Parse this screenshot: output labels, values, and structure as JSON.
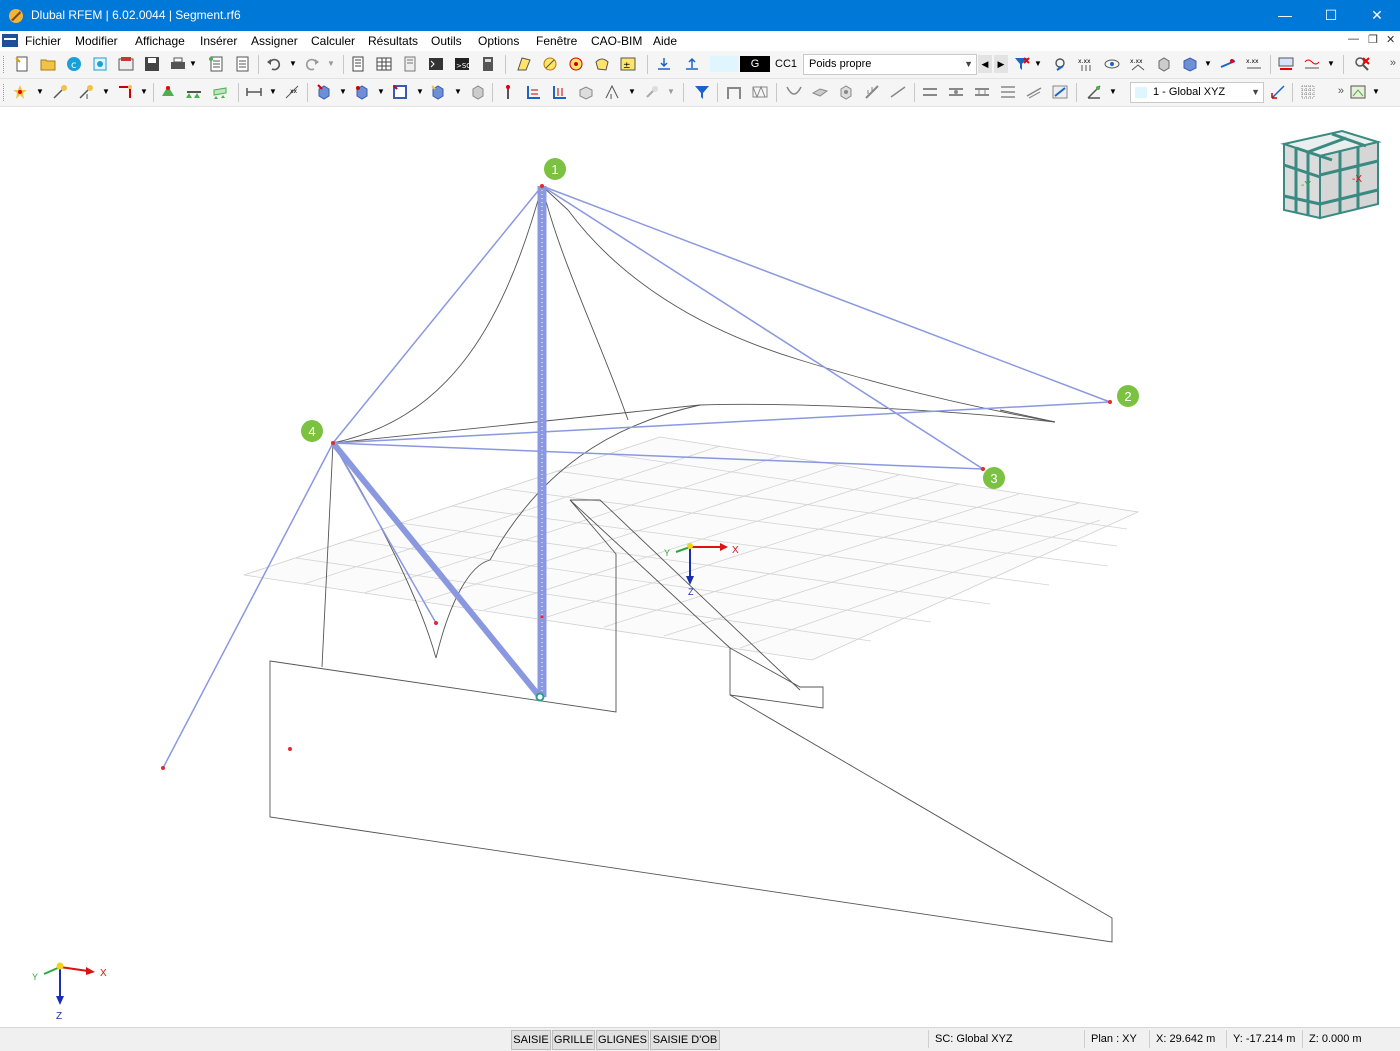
{
  "window": {
    "title": "Dlubal RFEM | 6.02.0044 | Segment.rf6",
    "minimize": "—",
    "maximize": "☐",
    "close": "✕"
  },
  "menu": {
    "items": [
      "Fichier",
      "Modifier",
      "Affichage",
      "Insérer",
      "Assigner",
      "Calculer",
      "Résultats",
      "Outils",
      "Options",
      "Fenêtre",
      "CAO-BIM",
      "Aide"
    ],
    "mdi_minimize": "—",
    "mdi_restore": "❐",
    "mdi_close": "✕"
  },
  "toolbar": {
    "load_case_type": "G",
    "load_case_code": "CC1",
    "load_case_name": "Poids propre",
    "coordinate_system": "1 - Global XYZ",
    "more": "»"
  },
  "viewport": {
    "node_labels": [
      "1",
      "2",
      "3",
      "4"
    ],
    "axis_x": "X",
    "axis_y": "Y",
    "axis_z": "Z",
    "navcube_y": "-Y",
    "navcube_x": "-X"
  },
  "status": {
    "buttons": [
      "SAISIE",
      "GRILLE",
      "GLIGNES",
      "SAISIE D'OB"
    ],
    "cs": "SC: Global XYZ",
    "plane": "Plan : XY",
    "x": "X: 29.642 m",
    "y": "Y: -17.214 m",
    "z": "Z: 0.000 m"
  },
  "colors": {
    "titlebar": "#0078d7",
    "member": "#8a98e0",
    "node_badge": "#7bc142",
    "node_point": "#e32b2b"
  }
}
